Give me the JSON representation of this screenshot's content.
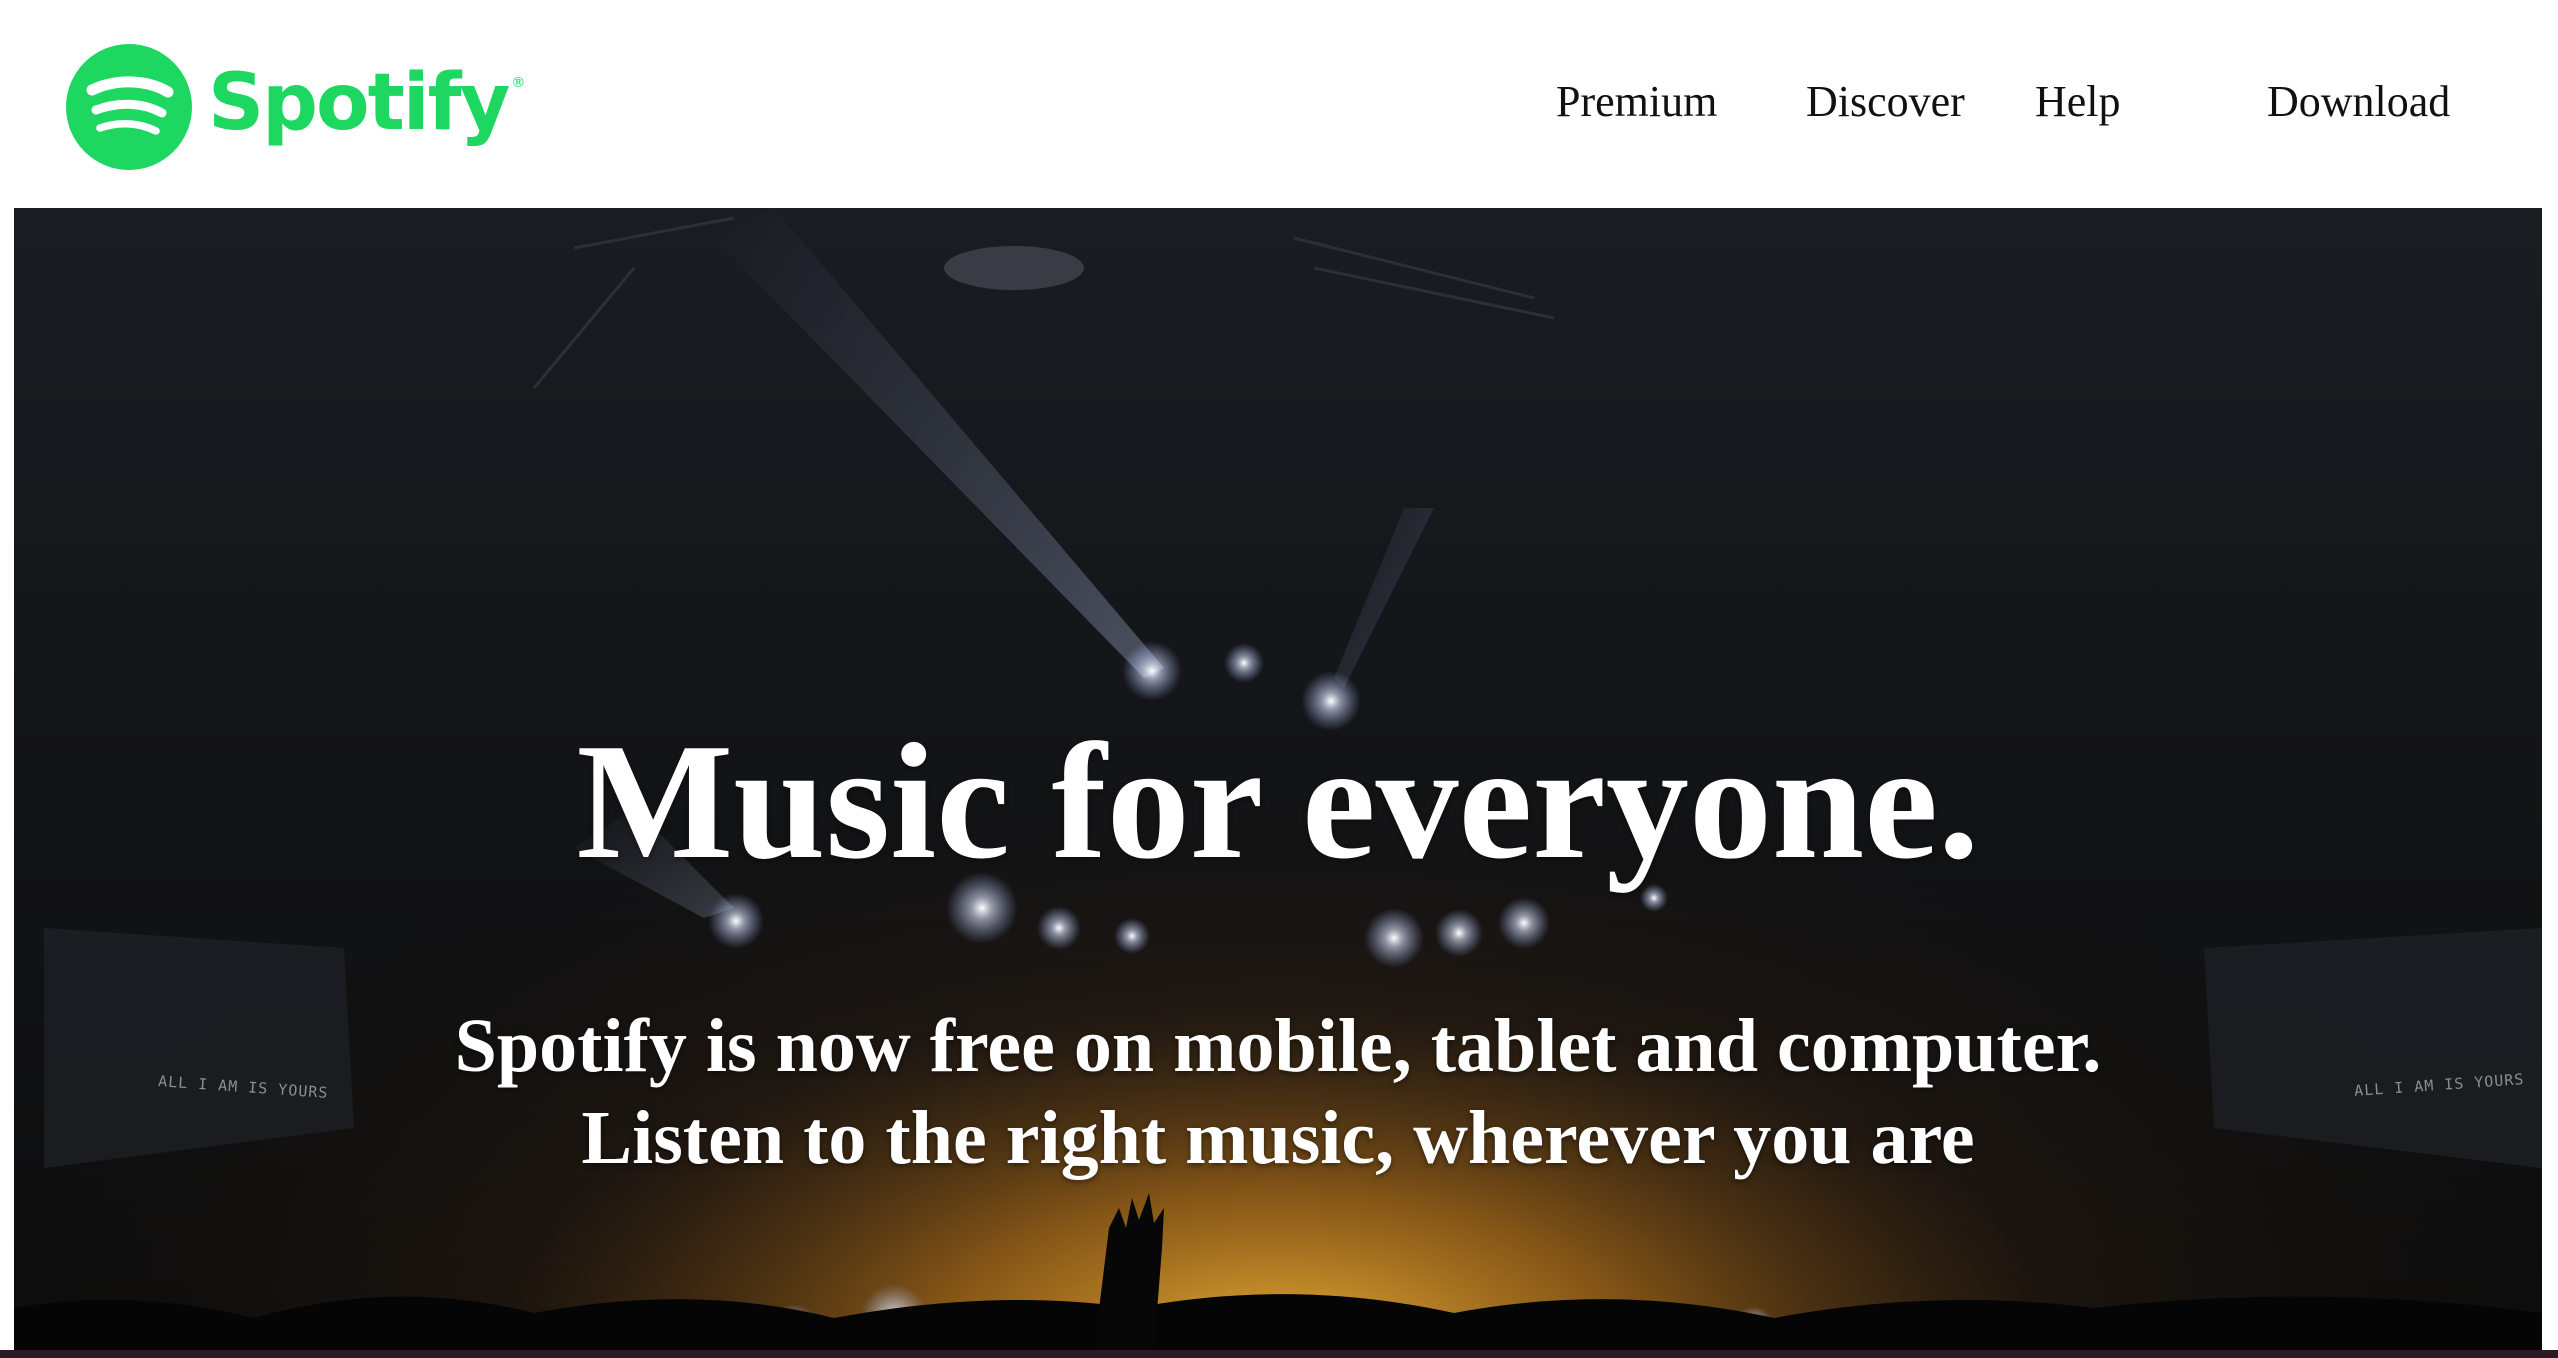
{
  "brand": {
    "name": "Spotify",
    "registered_mark": "®",
    "color": "#1ed760",
    "logo_icon": "spotify-logo-icon"
  },
  "nav": {
    "items": [
      {
        "label": "Premium"
      },
      {
        "label": "Discover"
      },
      {
        "label": "Help"
      },
      {
        "label": "Download"
      }
    ]
  },
  "hero": {
    "title": "Music for everyone.",
    "subtitle_line1": "Spotify is now free on mobile, tablet and computer.",
    "subtitle_line2": "Listen to the right music, wherever you are",
    "stage_text_left": "ALL I AM IS YOURS",
    "stage_text_right": "ALL I AM IS YOURS"
  },
  "colors": {
    "accent": "#1ed760",
    "nav_text": "#111111",
    "hero_text": "#ffffff",
    "hero_bg": "#0c0c0c"
  }
}
